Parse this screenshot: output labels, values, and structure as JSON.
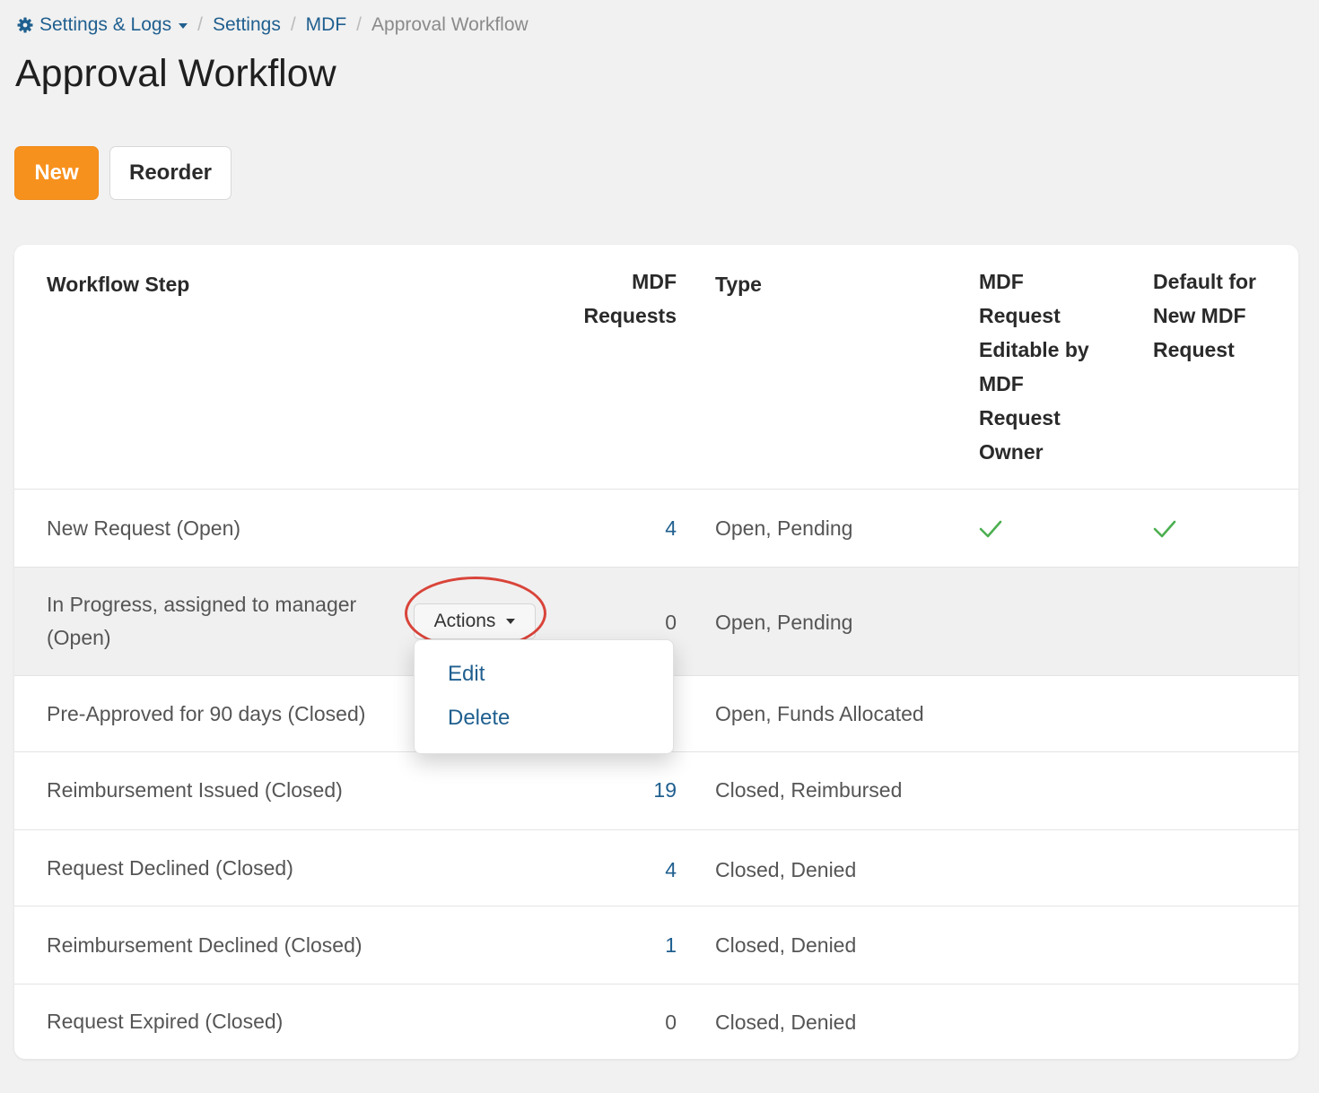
{
  "breadcrumb": {
    "root_label": "Settings & Logs",
    "items": [
      "Settings",
      "MDF"
    ],
    "current": "Approval Workflow",
    "icon": "gear-icon"
  },
  "page_title": "Approval Workflow",
  "toolbar": {
    "new_label": "New",
    "reorder_label": "Reorder"
  },
  "table": {
    "headers": {
      "workflow_step": "Workflow Step",
      "mdf_requests": [
        "MDF",
        "Requests"
      ],
      "type": "Type",
      "editable": [
        "MDF",
        "Request",
        "Editable by",
        "MDF",
        "Request",
        "Owner"
      ],
      "default": [
        "Default for",
        "New MDF",
        "Request"
      ]
    },
    "rows": [
      {
        "step": [
          "New Request (Open)"
        ],
        "count": "4",
        "type": "Open, Pending",
        "editable": true,
        "default": true
      },
      {
        "step": [
          "In Progress, assigned to manager",
          "(Open)"
        ],
        "count": "0",
        "type": "Open, Pending",
        "editable": false,
        "default": false
      },
      {
        "step": [
          "Pre-Approved for 90 days (Closed)"
        ],
        "count": "",
        "type": "Open, Funds Allocated",
        "editable": false,
        "default": false
      },
      {
        "step": [
          "Reimbursement Issued (Closed)"
        ],
        "count": "19",
        "type": "Closed, Reimbursed",
        "editable": false,
        "default": false
      },
      {
        "step": [
          "Request Declined (Closed)"
        ],
        "count": "4",
        "type": "Closed, Denied",
        "editable": false,
        "default": false
      },
      {
        "step": [
          "Reimbursement Declined (Closed)"
        ],
        "count": "1",
        "type": "Closed, Denied",
        "editable": false,
        "default": false
      },
      {
        "step": [
          "Request Expired (Closed)"
        ],
        "count": "0",
        "type": "Closed, Denied",
        "editable": false,
        "default": false
      }
    ]
  },
  "actions_menu": {
    "button_label": "Actions",
    "items": [
      "Edit",
      "Delete"
    ]
  },
  "colors": {
    "accent": "#f7911e",
    "link": "#1f5f8f",
    "check": "#4caf50",
    "highlight": "#d9443a"
  }
}
